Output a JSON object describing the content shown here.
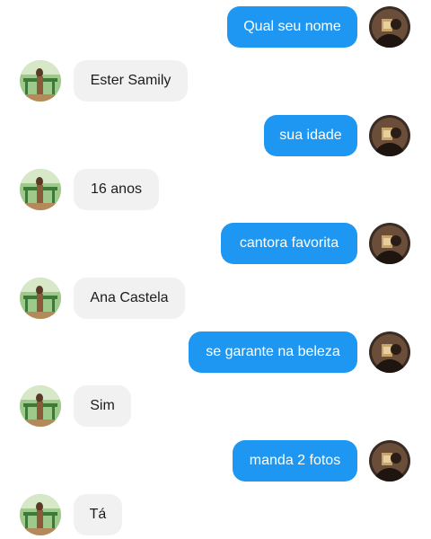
{
  "messages": [
    {
      "side": "out",
      "text": "Qual seu nome"
    },
    {
      "side": "in",
      "text": "Ester Samily"
    },
    {
      "side": "out",
      "text": "sua idade"
    },
    {
      "side": "in",
      "text": "16 anos"
    },
    {
      "side": "out",
      "text": "cantora favorita"
    },
    {
      "side": "in",
      "text": "Ana Castela"
    },
    {
      "side": "out",
      "text": "se garante na beleza"
    },
    {
      "side": "in",
      "text": "Sim"
    },
    {
      "side": "out",
      "text": "manda 2 fotos"
    },
    {
      "side": "in",
      "text": "Tá"
    }
  ],
  "colors": {
    "outgoing_bubble": "#1e97f3",
    "incoming_bubble": "#f1f1f2",
    "background": "#ffffff"
  },
  "icons": {
    "sender_avatar": "user-photo-avatar",
    "contact_avatar": "contact-photo-avatar"
  }
}
